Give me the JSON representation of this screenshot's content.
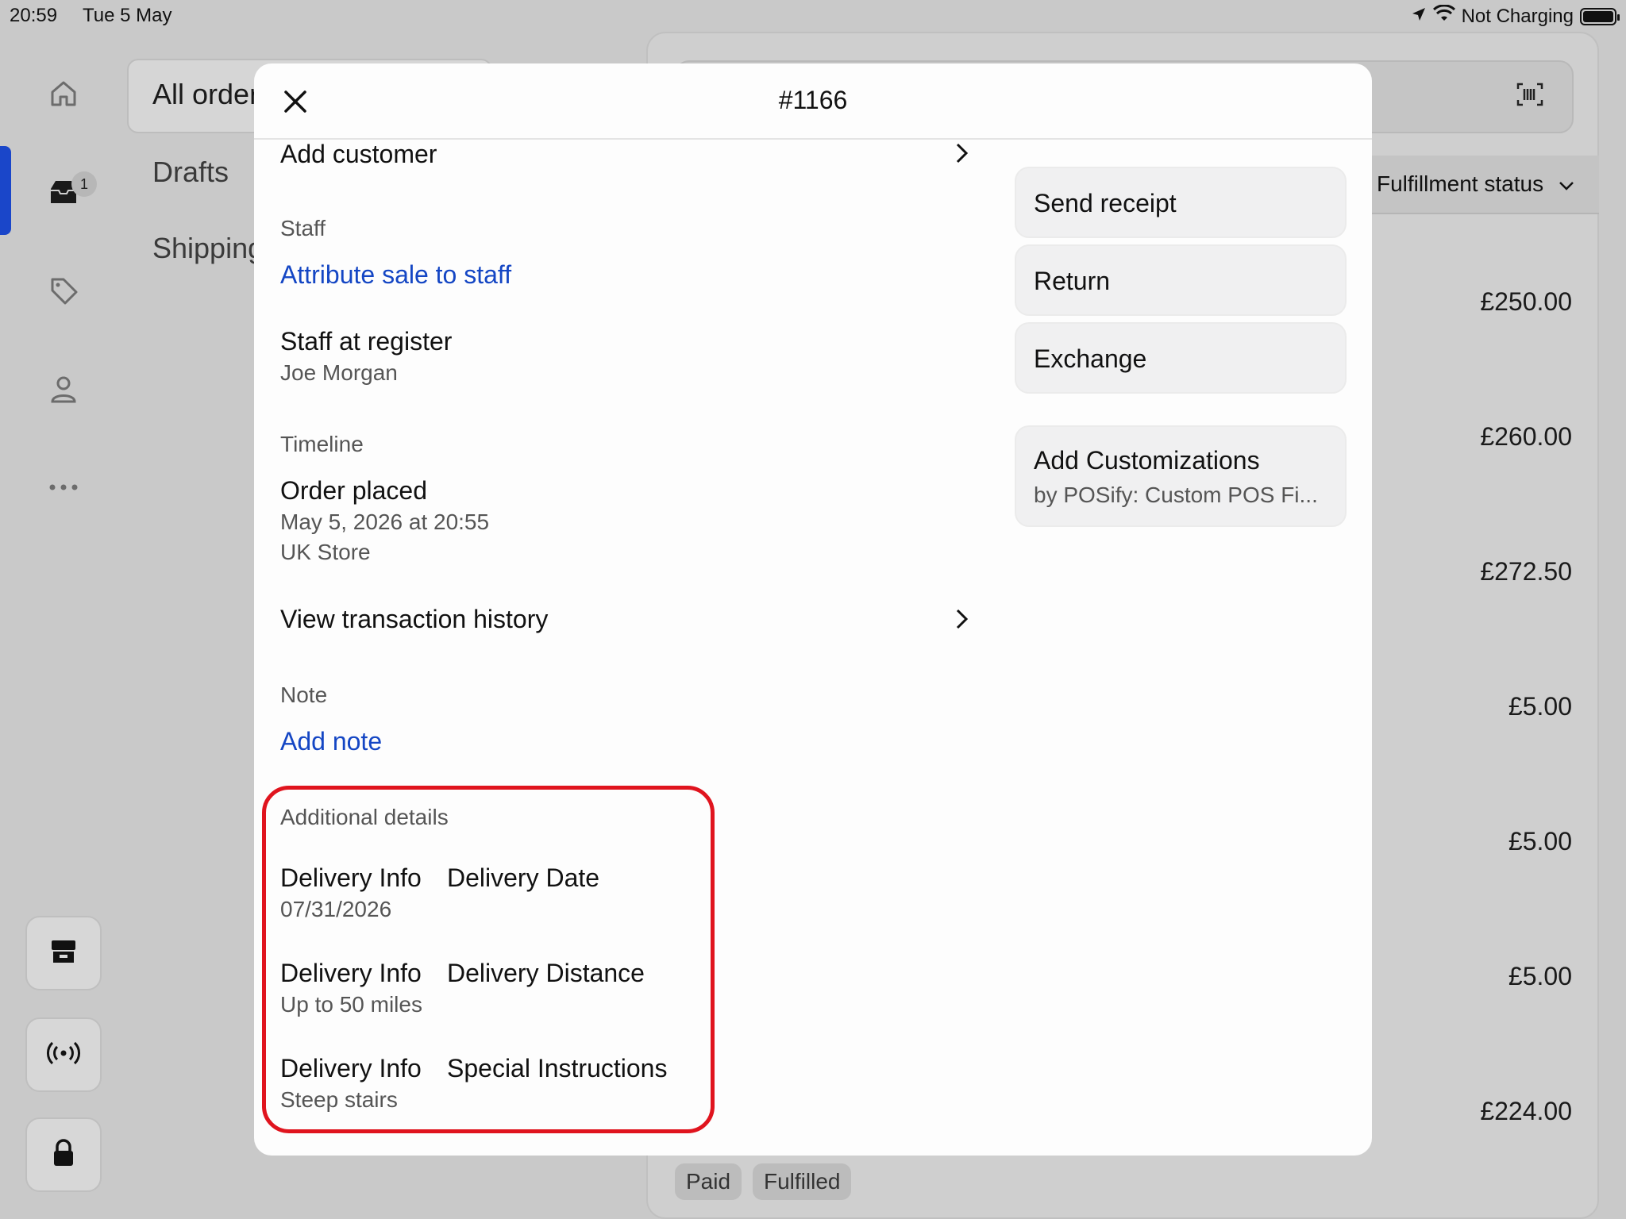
{
  "status_bar": {
    "time": "20:59",
    "date": "Tue 5 May",
    "battery_text": "Not Charging"
  },
  "sidebar": {
    "badge_count": "1",
    "icons": [
      "home-icon",
      "orders-inbox-icon",
      "tag-icon",
      "person-icon",
      "more-icon"
    ],
    "bottom_buttons": [
      "store-icon",
      "broadcast-icon",
      "lock-icon"
    ]
  },
  "secondary_nav": {
    "items": [
      "All order",
      "Drafts",
      "Shipping"
    ]
  },
  "background": {
    "filter_label": "Fulfillment status",
    "amounts": [
      "£250.00",
      "£260.00",
      "£272.50",
      "£5.00",
      "£5.00",
      "£5.00",
      "£224.00"
    ],
    "tags": [
      "Paid",
      "Fulfilled"
    ]
  },
  "modal": {
    "title": "#1166",
    "add_customer": "Add customer",
    "staff_label": "Staff",
    "attribute_sale": "Attribute sale to staff",
    "staff_at_register": "Staff at register",
    "staff_name": "Joe Morgan",
    "timeline_label": "Timeline",
    "order_placed": "Order placed",
    "order_date": "May 5, 2026 at 20:55",
    "order_store": "UK Store",
    "view_history": "View transaction history",
    "note_label": "Note",
    "add_note": "Add note",
    "additional_label": "Additional details",
    "details": [
      {
        "group": "Delivery Info",
        "field": "Delivery Date",
        "value": "07/31/2026"
      },
      {
        "group": "Delivery Info",
        "field": "Delivery Distance",
        "value": "Up to 50 miles"
      },
      {
        "group": "Delivery Info",
        "field": "Special Instructions",
        "value": "Steep stairs"
      }
    ],
    "actions": {
      "send_receipt": "Send receipt",
      "return": "Return",
      "exchange": "Exchange",
      "customizations_title": "Add Customizations",
      "customizations_sub": "by POSify: Custom POS Fi..."
    }
  },
  "colors": {
    "link": "#1446c4",
    "highlight": "#e0141e",
    "active_rail": "#1a46c9"
  }
}
